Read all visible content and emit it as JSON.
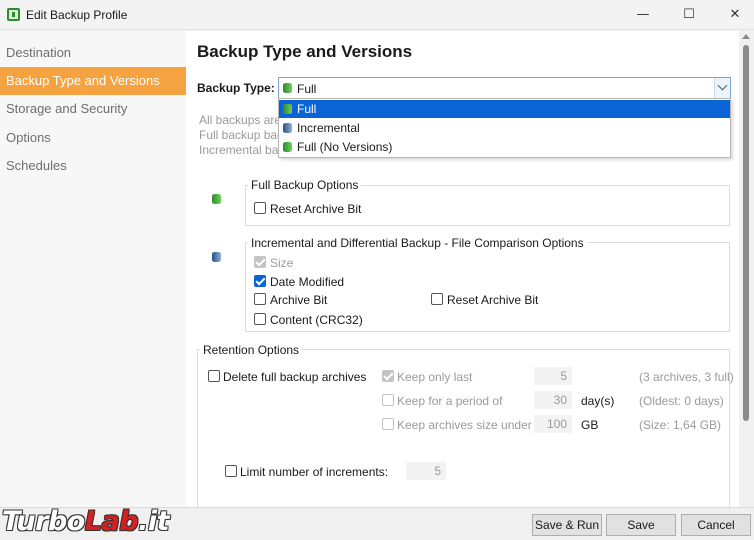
{
  "window": {
    "title": "Edit Backup Profile",
    "minimize": "—",
    "maximize": "☐",
    "close": "✕"
  },
  "sidebar": {
    "items": [
      {
        "label": "Destination"
      },
      {
        "label": "Backup Type and Versions"
      },
      {
        "label": "Storage and Security"
      },
      {
        "label": "Options"
      },
      {
        "label": "Schedules"
      }
    ]
  },
  "main": {
    "title": "Backup Type and Versions",
    "backup_type_label": "Backup Type:",
    "backup_type_value": "Full",
    "description_fragments": [
      "All backups are",
      "Full backup back",
      "Incremental bac"
    ]
  },
  "dropdown": {
    "options": [
      {
        "label": "Full",
        "selected": true
      },
      {
        "label": "Incremental",
        "selected": false
      },
      {
        "label": "Full (No Versions)",
        "selected": false
      }
    ]
  },
  "full_options": {
    "title": "Full Backup Options",
    "reset_archive_bit": "Reset Archive Bit"
  },
  "incremental_options": {
    "title": "Incremental and Differential Backup - File Comparison Options",
    "size": "Size",
    "date_modified": "Date Modified",
    "archive_bit": "Archive Bit",
    "reset_archive_bit": "Reset Archive Bit",
    "content": "Content (CRC32)"
  },
  "retention": {
    "title": "Retention Options",
    "delete_full": "Delete full backup archives",
    "keep_only_last": {
      "label": "Keep only last",
      "value": "5",
      "unit": "",
      "info": "(3 archives, 3 full)"
    },
    "keep_period": {
      "label": "Keep for a period of",
      "value": "30",
      "unit": "day(s)",
      "info": "(Oldest: 0 days)"
    },
    "keep_size": {
      "label": "Keep archives size under",
      "value": "100",
      "unit": "GB",
      "info": "(Size: 1,64 GB)"
    },
    "limit_increments": {
      "label": "Limit number of increments:",
      "value": "5"
    }
  },
  "footer": {
    "save_run": "Save & Run",
    "save": "Save",
    "cancel": "Cancel"
  },
  "watermark": {
    "part1": "Turbo",
    "part2": "Lab",
    "part3": ".it"
  }
}
